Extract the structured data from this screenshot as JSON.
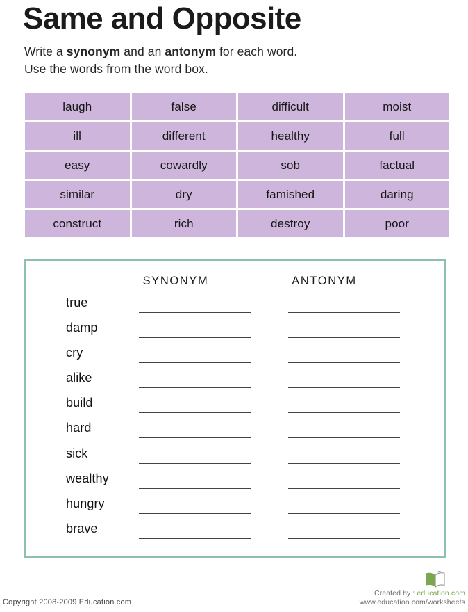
{
  "header": {
    "title": "Same and Opposite",
    "instruction_line1_pre": "Write a ",
    "instruction_line1_bold1": "synonym",
    "instruction_line1_mid": " and an ",
    "instruction_line1_bold2": "antonym",
    "instruction_line1_post": " for each word.",
    "instruction_line2": "Use the words from the word box."
  },
  "word_box": {
    "fill_color": "#cdb5dc",
    "rows": 5,
    "columns": 4,
    "words": [
      "laugh",
      "false",
      "difficult",
      "moist",
      "ill",
      "different",
      "healthy",
      "full",
      "easy",
      "cowardly",
      "sob",
      "factual",
      "similar",
      "dry",
      "famished",
      "daring",
      "construct",
      "rich",
      "destroy",
      "poor"
    ]
  },
  "answer_panel": {
    "border_color": "#8fbfad",
    "column_headers": {
      "synonym": "SYNONYM",
      "antonym": "ANTONYM"
    },
    "words": [
      "true",
      "damp",
      "cry",
      "alike",
      "build",
      "hard",
      "sick",
      "wealthy",
      "hungry",
      "brave"
    ]
  },
  "footer": {
    "copyright": "Copyright 2008-2009 Education.com",
    "created_by_prefix": "Created by : ",
    "created_by_brand": "education.com",
    "website": "www.education.com/worksheets",
    "logo_color": "#7aa84f"
  }
}
